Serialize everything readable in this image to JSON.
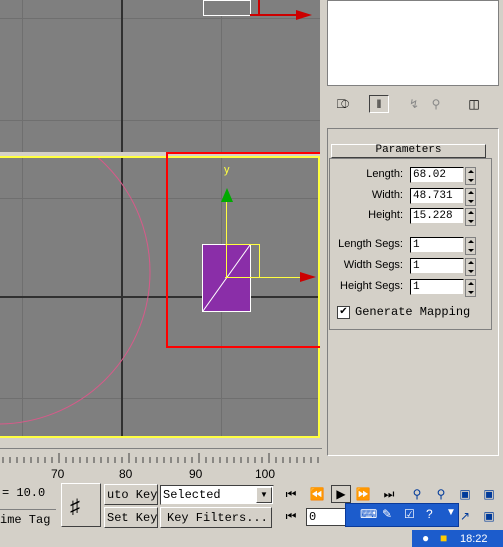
{
  "viewport": {
    "axis_label": "y",
    "ruler_ticks": [
      "70",
      "80",
      "90",
      "100"
    ]
  },
  "panel": {
    "rollout_title": "Parameters",
    "fields": [
      {
        "label": "Length:",
        "value": "68.02"
      },
      {
        "label": "Width:",
        "value": "48.731"
      },
      {
        "label": "Height:",
        "value": "15.228"
      },
      {
        "label": "Length Segs:",
        "value": "1"
      },
      {
        "label": "Width Segs:",
        "value": "1"
      },
      {
        "label": "Height Segs:",
        "value": "1"
      }
    ],
    "checkbox_label": "Generate Mapping"
  },
  "bottom": {
    "coord_text": "= 10.0",
    "time_tag": "ime Tag",
    "auto_key": "uto Key",
    "set_key": "Set Key",
    "selected_value": "Selected",
    "key_filters": "Key Filters...",
    "frame_value": "0"
  },
  "taskbar": {
    "clock": "18:22"
  },
  "colors": {
    "selection_rect": "#ff0000",
    "viewport_border": "#ffff40",
    "box_fill": "#8a2ea8",
    "circle": "#d85a8a"
  }
}
